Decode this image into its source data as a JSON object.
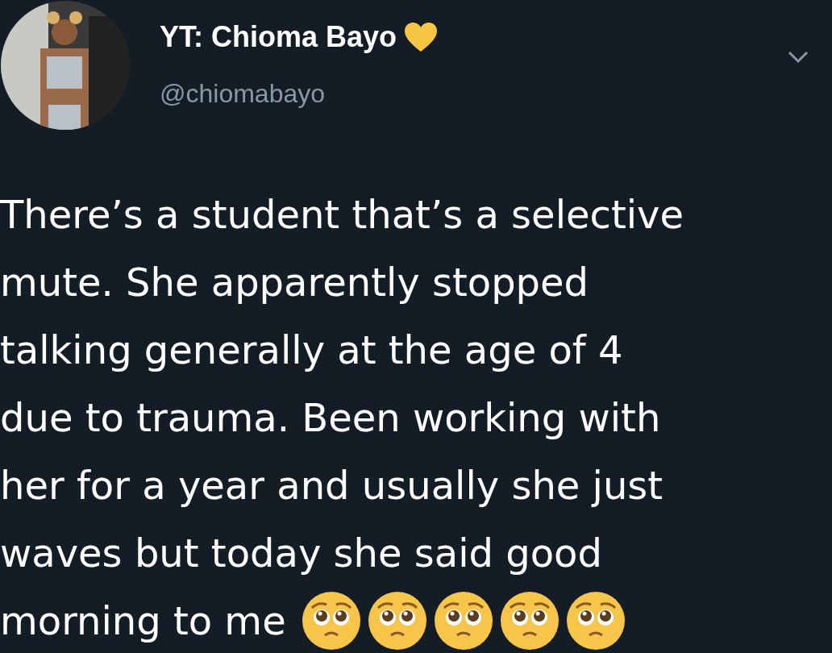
{
  "author": {
    "name": "YT: Chioma Bayo",
    "handle": "@chiomabayo",
    "badge": {
      "kind": "heart",
      "color": "#f7c544"
    }
  },
  "tweet": {
    "lines": [
      "There’s a student that’s a selective",
      "mute. She apparently stopped",
      "talking generally at the age of 4",
      "due to trauma. Been working with",
      "her for a year and usually she just",
      "waves but today she said good",
      "morning to me"
    ],
    "emojis": [
      {
        "kind": "pleading"
      },
      {
        "kind": "pleading"
      },
      {
        "kind": "pleading"
      },
      {
        "kind": "pleading"
      },
      {
        "kind": "pleading"
      }
    ]
  }
}
